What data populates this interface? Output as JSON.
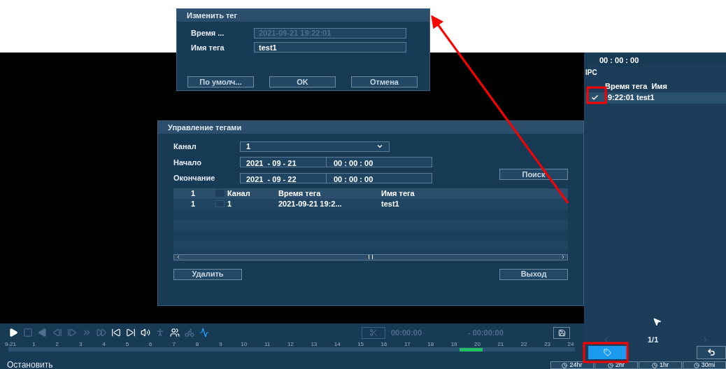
{
  "edit_tag_dialog": {
    "title": "Изменить тег",
    "fields": [
      {
        "label": "Время ...",
        "value": "2021-09-21 19:22:01",
        "disabled": true
      },
      {
        "label": "Имя тега",
        "value": "test1",
        "disabled": false
      }
    ],
    "buttons": [
      "По умолч...",
      "OK",
      "Отмена"
    ]
  },
  "tag_manager_dialog": {
    "title": "Управление тегами",
    "channel": {
      "label": "Канал",
      "value": "1"
    },
    "start": {
      "label": "Начало",
      "date": "2021  - 09 - 21",
      "time": "00 : 00 : 00"
    },
    "end": {
      "label": "Окончание",
      "date": "2021  - 09 - 22",
      "time": "00 : 00 : 00"
    },
    "search_button": "Поиск",
    "table": {
      "columns": [
        "1",
        "Канал",
        "Время тега",
        "Имя тега"
      ],
      "header_checked": false,
      "rows": [
        {
          "cells": [
            "1",
            "1",
            "2021-09-21 19:2...",
            "test1"
          ],
          "checked": false
        }
      ]
    },
    "delete_button": "Удалить",
    "exit_button": "Выход"
  },
  "playback_controls": [
    {
      "kind": "play",
      "disabled": false
    },
    {
      "kind": "stop",
      "disabled": true
    },
    {
      "kind": "reverse",
      "disabled": true
    },
    {
      "kind": "step_back",
      "disabled": true
    },
    {
      "kind": "step_forward",
      "disabled": true
    },
    {
      "kind": "slow",
      "disabled": true
    },
    {
      "kind": "fast",
      "disabled": true
    },
    {
      "kind": "prev",
      "disabled": false
    },
    {
      "kind": "next",
      "disabled": false
    },
    {
      "kind": "volume",
      "disabled": false
    },
    {
      "kind": "person",
      "disabled": true
    },
    {
      "kind": "group",
      "disabled": false
    },
    {
      "kind": "vehicle",
      "disabled": true
    },
    {
      "kind": "smart",
      "disabled": false
    }
  ],
  "clip": {
    "start": "00:00:00",
    "end": "- 00:00:00"
  },
  "timeline": {
    "labels": [
      "9-21",
      "1",
      "2",
      "3",
      "4",
      "5",
      "6",
      "7",
      "8",
      "9",
      "10",
      "11",
      "12",
      "13",
      "14",
      "15",
      "16",
      "17",
      "18",
      "19",
      "20",
      "21",
      "22",
      "23",
      "24"
    ]
  },
  "status_text": "Остановить",
  "side_panel": {
    "time": "00 : 00 : 00",
    "group": "IPC",
    "columns": [
      "Время тега",
      "Имя"
    ],
    "tags": [
      {
        "text": "9:22:01 test1",
        "checked": true
      }
    ],
    "page": "1/1"
  },
  "time_ranges": [
    "24hr",
    "2hr",
    "1hr",
    "30mi"
  ]
}
